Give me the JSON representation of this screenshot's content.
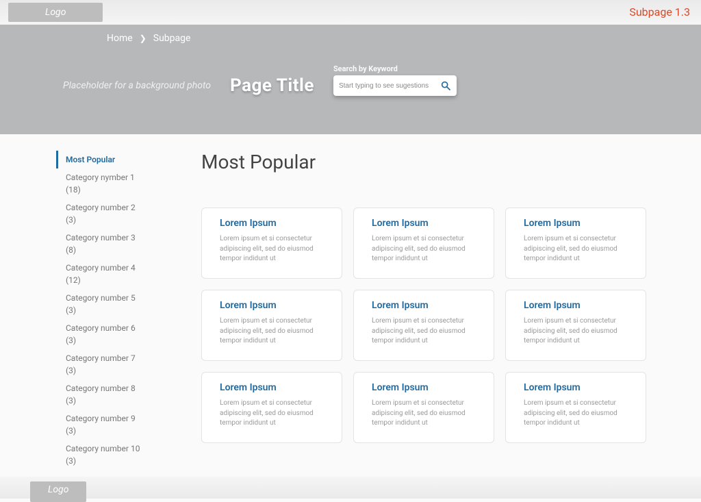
{
  "topbar": {
    "logo": "Logo",
    "subpage_label": "Subpage 1.3"
  },
  "hero": {
    "breadcrumb": [
      "Home",
      "Subpage"
    ],
    "bg_placeholder": "Placeholder for a background photo",
    "page_title": "Page Title",
    "search_label": "Search by Keyword",
    "search_placeholder": "Start typing to see sugestions"
  },
  "sidebar": {
    "items": [
      {
        "label": "Most Popular",
        "active": true
      },
      {
        "label": "Category nymber 1 (18)"
      },
      {
        "label": "Category number 2 (3)"
      },
      {
        "label": "Category number 3 (8)"
      },
      {
        "label": "Category number 4 (12)"
      },
      {
        "label": "Category number 5 (3)"
      },
      {
        "label": "Category number 6 (3)"
      },
      {
        "label": "Category number 7 (3)"
      },
      {
        "label": "Category number 8 (3)"
      },
      {
        "label": "Category number 9 (3)"
      },
      {
        "label": "Category number 10 (3)"
      }
    ]
  },
  "content": {
    "section_title": "Most Popular",
    "cards": [
      {
        "title": "Lorem Ipsum",
        "body": "Lorem ipsum et si consectetur adipiscing elit, sed do eiusmod tempor indidunt ut"
      },
      {
        "title": "Lorem Ipsum",
        "body": "Lorem ipsum et si consectetur adipiscing elit, sed do eiusmod tempor indidunt ut"
      },
      {
        "title": "Lorem Ipsum",
        "body": "Lorem ipsum et si consectetur adipiscing elit, sed do eiusmod tempor indidunt ut"
      },
      {
        "title": "Lorem Ipsum",
        "body": "Lorem ipsum et si consectetur adipiscing elit, sed do eiusmod tempor indidunt ut"
      },
      {
        "title": "Lorem Ipsum",
        "body": "Lorem ipsum et si consectetur adipiscing elit, sed do eiusmod tempor indidunt ut"
      },
      {
        "title": "Lorem Ipsum",
        "body": "Lorem ipsum et si consectetur adipiscing elit, sed do eiusmod tempor indidunt ut"
      },
      {
        "title": "Lorem Ipsum",
        "body": "Lorem ipsum et si consectetur adipiscing elit, sed do eiusmod tempor indidunt ut"
      },
      {
        "title": "Lorem Ipsum",
        "body": "Lorem ipsum et si consectetur adipiscing elit, sed do eiusmod tempor indidunt ut"
      },
      {
        "title": "Lorem Ipsum",
        "body": "Lorem ipsum et si consectetur adipiscing elit, sed do eiusmod tempor indidunt ut"
      }
    ]
  },
  "bottombar": {
    "logo": "Logo"
  }
}
